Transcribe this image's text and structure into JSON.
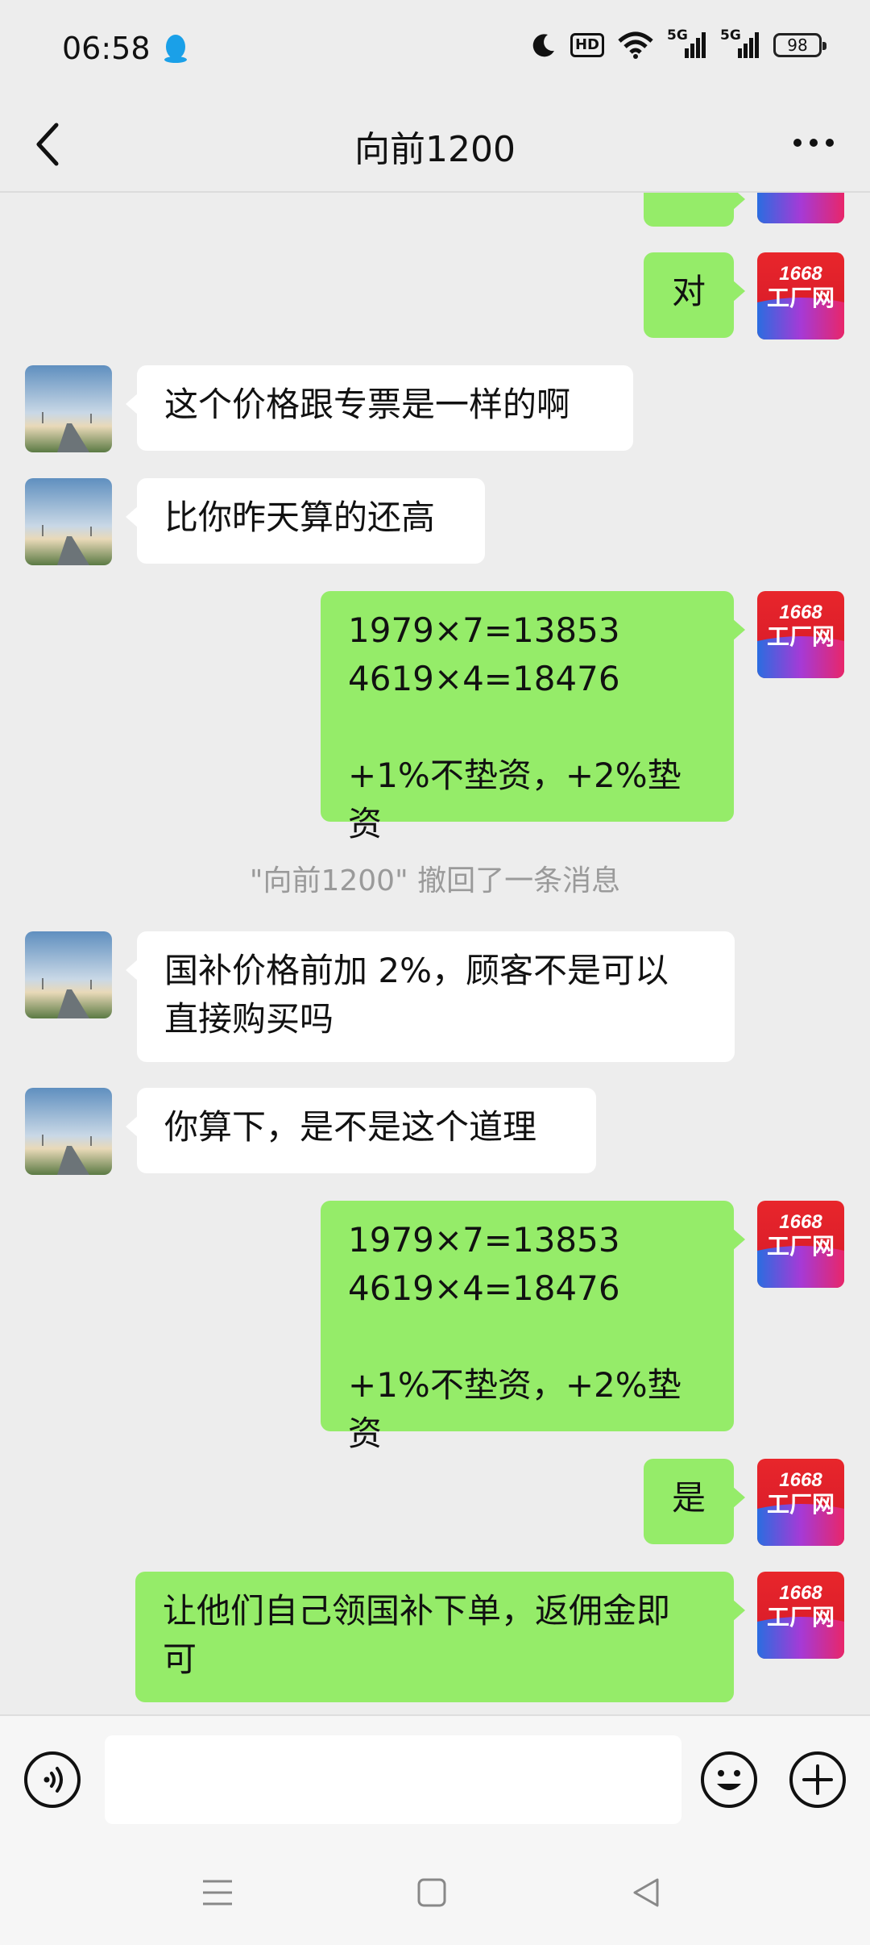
{
  "status_bar": {
    "time": "06:58",
    "hd_label": "HD",
    "signal_1_label": "5G",
    "signal_2_label": "5G",
    "battery": "98"
  },
  "header": {
    "title": "向前1200"
  },
  "avatar_badge": {
    "number": "1668",
    "name": "工厂网"
  },
  "messages": {
    "m0": "对",
    "m1": "这个价格跟专票是一样的啊",
    "m2": "比你昨天算的还高",
    "m3": "1979×7=13853\n4619×4=18476\n\n+1%不垫资，+2%垫资",
    "system": "\"向前1200\" 撤回了一条消息",
    "m4": "国补价格前加 2%，顾客不是可以\n直接购买吗",
    "m5": "你算下，是不是这个道理",
    "m6": "1979×7=13853\n4619×4=18476\n\n+1%不垫资，+2%垫资",
    "m7": "是",
    "m8": "让他们自己领国补下单，返佣金即\n可"
  },
  "colors": {
    "my_bubble": "#95ec69",
    "peer_bubble": "#ffffff",
    "background": "#ededed"
  }
}
